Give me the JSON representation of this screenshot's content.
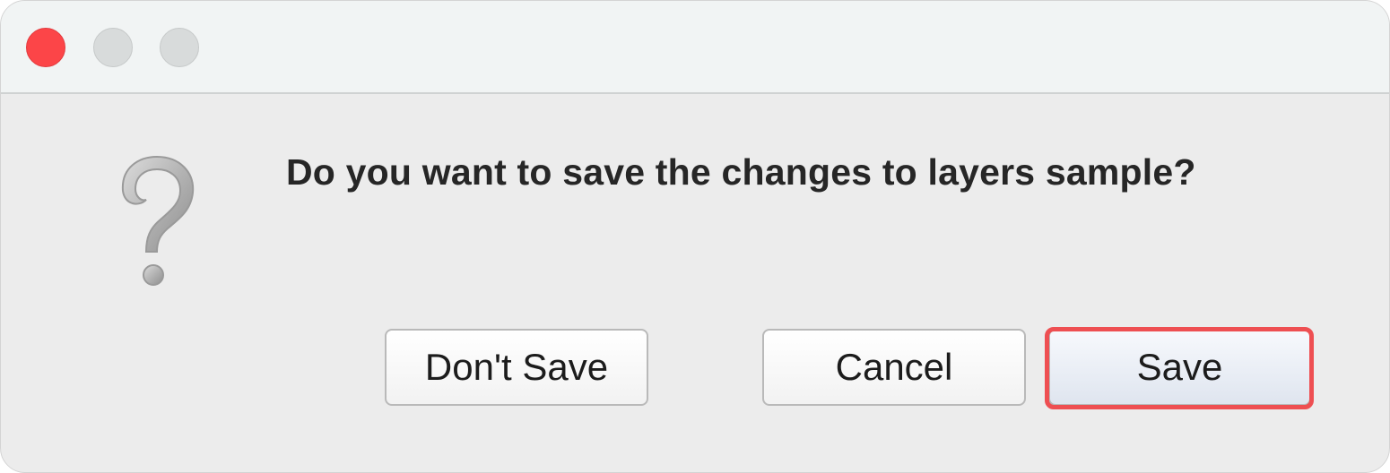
{
  "window": {
    "controls": {
      "close": {
        "icon": "close-icon",
        "color": "#fc4548"
      },
      "minimize": {
        "icon": "minimize-icon",
        "color": "#d8dbdb"
      },
      "zoom": {
        "icon": "zoom-icon",
        "color": "#d8dbdb"
      }
    }
  },
  "dialog": {
    "icon": "question-mark-icon",
    "message": "Do you want to save the changes to layers sample?",
    "buttons": {
      "dont_save": "Don't Save",
      "cancel": "Cancel",
      "save": "Save"
    },
    "highlight_color": "#ee4f52"
  }
}
